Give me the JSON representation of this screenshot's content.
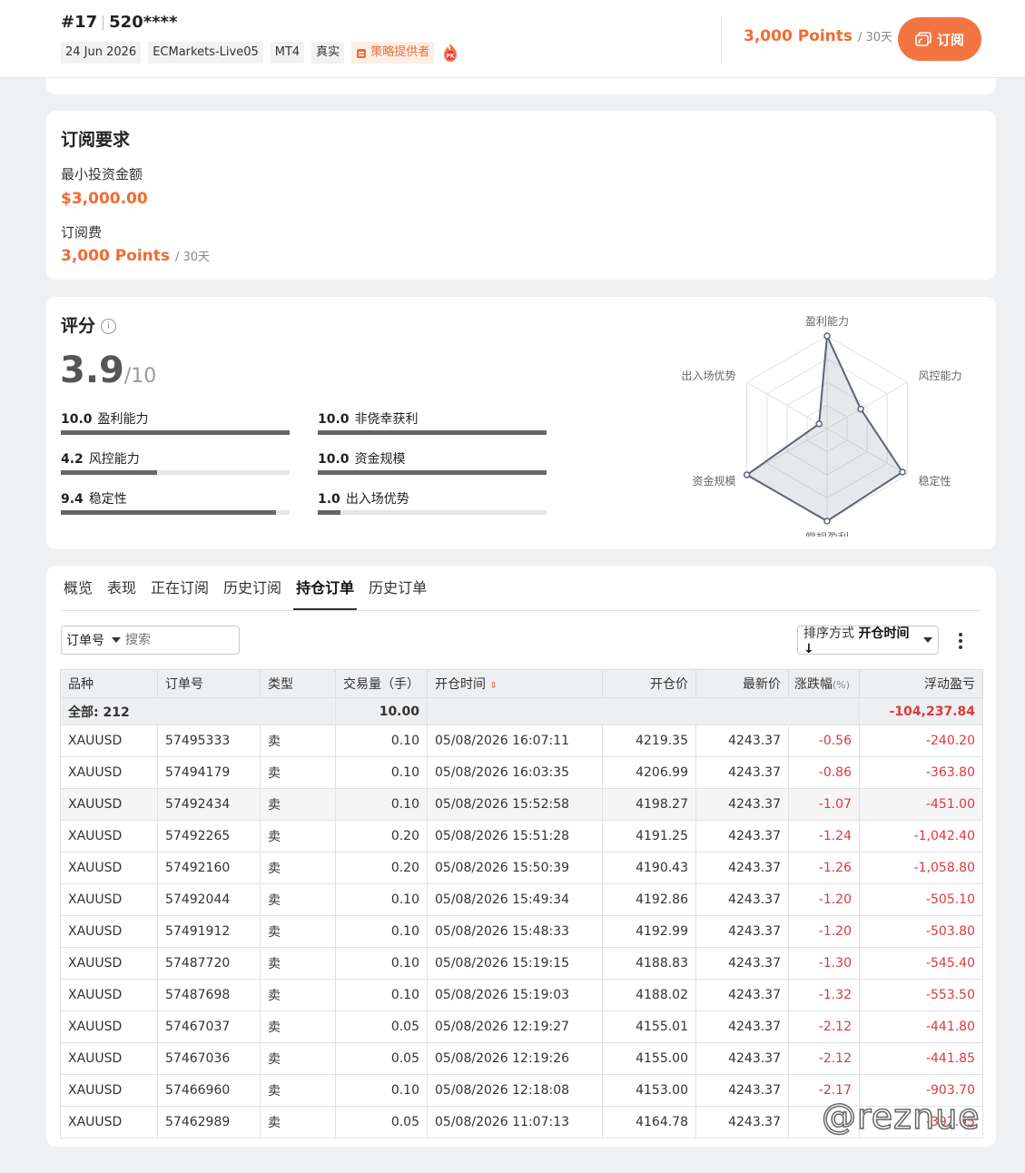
{
  "header": {
    "rank": "#17",
    "account": "520****",
    "tags": [
      "24 Jun 2026",
      "ECMarkets-Live05",
      "MT4",
      "真实"
    ],
    "provider_tag": "策略提供者",
    "price": "3,000 Points",
    "period": "/ 30天",
    "subscribe_label": "订阅",
    "accent_color": "#f26b31"
  },
  "requirements": {
    "title": "订阅要求",
    "min_label": "最小投资金额",
    "min_value": "$3,000.00",
    "fee_label": "订阅费",
    "fee_value": "3,000 Points",
    "fee_period": "/ 30天"
  },
  "score": {
    "title": "评分",
    "info_glyph": "i",
    "value": "3.9",
    "of": "/10",
    "metrics": [
      {
        "score": "10.0",
        "label": "盈利能力",
        "fraction": 1.0
      },
      {
        "score": "10.0",
        "label": "非侥幸获利",
        "fraction": 1.0
      },
      {
        "score": "4.2",
        "label": "风控能力",
        "fraction": 0.42
      },
      {
        "score": "10.0",
        "label": "资金规模",
        "fraction": 1.0
      },
      {
        "score": "9.4",
        "label": "稳定性",
        "fraction": 0.94
      },
      {
        "score": "1.0",
        "label": "出入场优势",
        "fraction": 0.1
      }
    ],
    "radar": {
      "axes": [
        "盈利能力",
        "风控能力",
        "稳定性",
        "常规盈利",
        "资金规模",
        "出入场优势"
      ],
      "values": [
        10.0,
        4.2,
        9.4,
        10.0,
        10.0,
        1.0
      ]
    }
  },
  "orders": {
    "tabs": [
      "概览",
      "表现",
      "正在订阅",
      "历史订阅",
      "持仓订单",
      "历史订单"
    ],
    "active_tab": "持仓订单",
    "filter_select": "订单号",
    "search_placeholder": "搜索",
    "sort_label": "排序方式",
    "sort_value": "开仓时间 ↓",
    "columns": [
      "品种",
      "订单号",
      "类型",
      "交易量（手）",
      "开仓时间",
      "开仓价",
      "最新价",
      "涨跌幅",
      "(%)",
      "浮动盈亏"
    ],
    "total": {
      "label": "全部: 212",
      "volume": "10.00",
      "pnl": "-104,237.84"
    },
    "rows": [
      [
        "XAUUSD",
        "57495333",
        "卖",
        "0.10",
        "05/08/2026 16:07:11",
        "4219.35",
        "4243.37",
        "-0.56",
        "-240.20"
      ],
      [
        "XAUUSD",
        "57494179",
        "卖",
        "0.10",
        "05/08/2026 16:03:35",
        "4206.99",
        "4243.37",
        "-0.86",
        "-363.80"
      ],
      [
        "XAUUSD",
        "57492434",
        "卖",
        "0.10",
        "05/08/2026 15:52:58",
        "4198.27",
        "4243.37",
        "-1.07",
        "-451.00"
      ],
      [
        "XAUUSD",
        "57492265",
        "卖",
        "0.20",
        "05/08/2026 15:51:28",
        "4191.25",
        "4243.37",
        "-1.24",
        "-1,042.40"
      ],
      [
        "XAUUSD",
        "57492160",
        "卖",
        "0.20",
        "05/08/2026 15:50:39",
        "4190.43",
        "4243.37",
        "-1.26",
        "-1,058.80"
      ],
      [
        "XAUUSD",
        "57492044",
        "卖",
        "0.10",
        "05/08/2026 15:49:34",
        "4192.86",
        "4243.37",
        "-1.20",
        "-505.10"
      ],
      [
        "XAUUSD",
        "57491912",
        "卖",
        "0.10",
        "05/08/2026 15:48:33",
        "4192.99",
        "4243.37",
        "-1.20",
        "-503.80"
      ],
      [
        "XAUUSD",
        "57487720",
        "卖",
        "0.10",
        "05/08/2026 15:19:15",
        "4188.83",
        "4243.37",
        "-1.30",
        "-545.40"
      ],
      [
        "XAUUSD",
        "57487698",
        "卖",
        "0.10",
        "05/08/2026 15:19:03",
        "4188.02",
        "4243.37",
        "-1.32",
        "-553.50"
      ],
      [
        "XAUUSD",
        "57467037",
        "卖",
        "0.05",
        "05/08/2026 12:19:27",
        "4155.01",
        "4243.37",
        "-2.12",
        "-441.80"
      ],
      [
        "XAUUSD",
        "57467036",
        "卖",
        "0.05",
        "05/08/2026 12:19:26",
        "4155.00",
        "4243.37",
        "-2.12",
        "-441.85"
      ],
      [
        "XAUUSD",
        "57466960",
        "卖",
        "0.10",
        "05/08/2026 12:18:08",
        "4153.00",
        "4243.37",
        "-2.17",
        "-903.70"
      ],
      [
        "XAUUSD",
        "57462989",
        "卖",
        "0.05",
        "05/08/2026 11:07:13",
        "4164.78",
        "4243.37",
        "",
        "-392.95"
      ]
    ]
  },
  "watermark": "@reznue"
}
